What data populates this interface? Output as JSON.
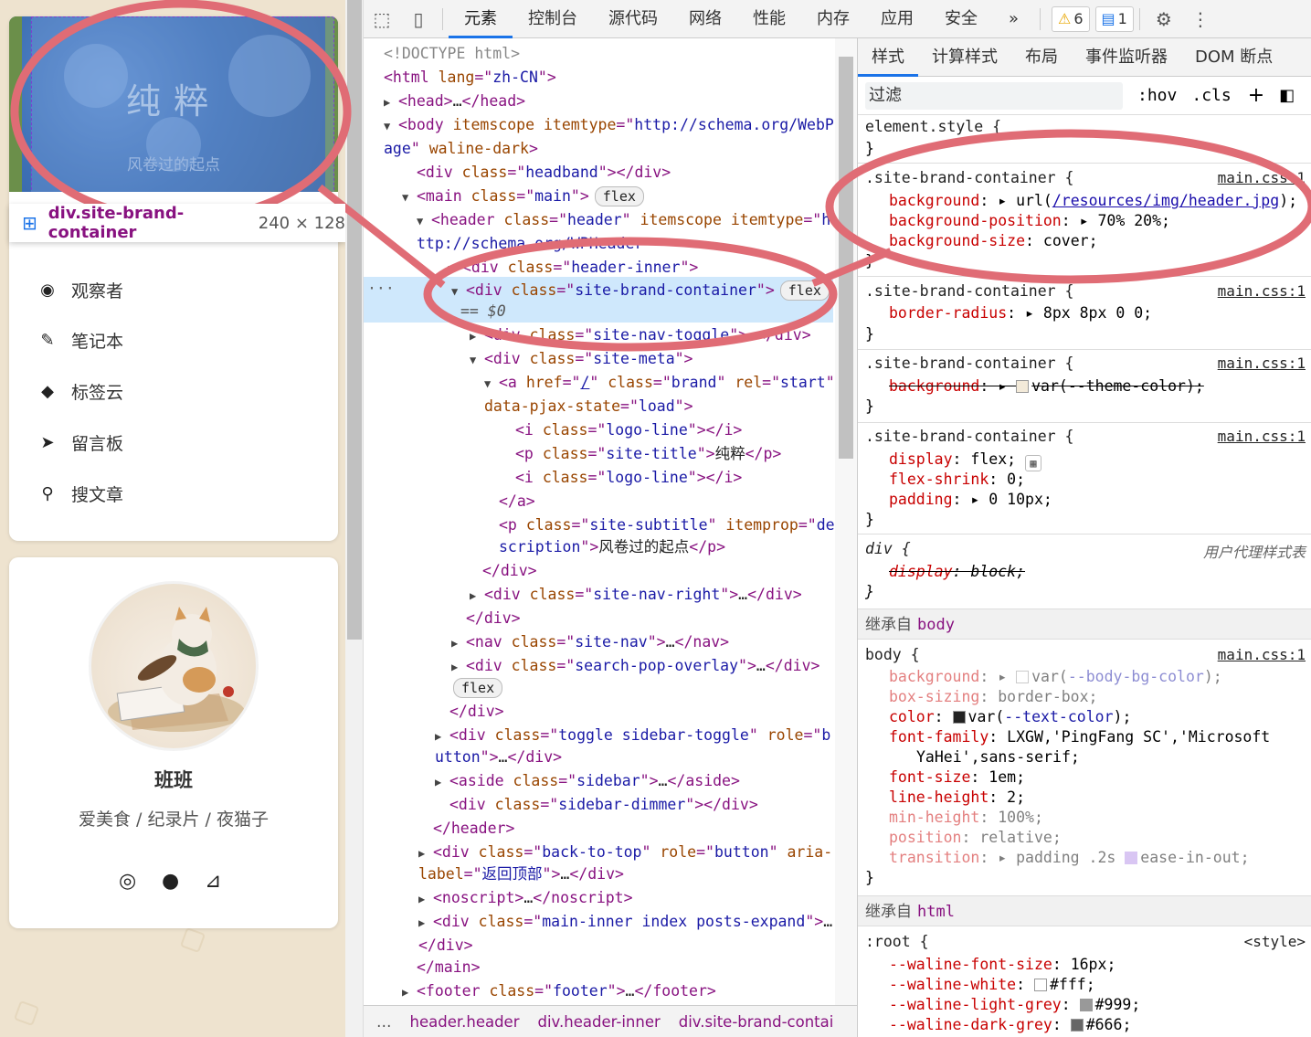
{
  "site": {
    "title": "纯粹",
    "subtitle": "风卷过的起点",
    "inspect_tooltip": {
      "selector": "div.site-brand-container",
      "size": "240 × 128"
    },
    "menu": [
      {
        "label": "观察者",
        "icon": "eye-icon"
      },
      {
        "label": "笔记本",
        "icon": "pencil-icon"
      },
      {
        "label": "标签云",
        "icon": "tags-icon"
      },
      {
        "label": "留言板",
        "icon": "send-icon"
      },
      {
        "label": "搜文章",
        "icon": "search-icon"
      }
    ],
    "profile": {
      "name": "班班",
      "description": "爱美食 / 纪录片 / 夜猫子",
      "social": [
        "weibo-icon",
        "github-icon",
        "rss-icon"
      ]
    }
  },
  "devtools": {
    "tabs": [
      "元素",
      "控制台",
      "源代码",
      "网络",
      "性能",
      "内存",
      "应用",
      "安全"
    ],
    "active_tab": "元素",
    "more": "»",
    "warnings": "6",
    "messages": "1",
    "elements": {
      "doctype": "<!DOCTYPE html>",
      "html_lang": "zh-CN",
      "body_itemtype_1": "http://schema.org/WebP",
      "body_itemtype_2": "age",
      "header_itemtype_1": "h",
      "header_itemtype_2": "ttp://schema.org/WPHeader",
      "site_title": "纯粹",
      "site_subtitle": "风卷过的起点",
      "selected_marker": "== $0",
      "back_to_top_label": "返回顶部",
      "breadcrumbs": [
        "header.header",
        "div.header-inner",
        "div.site-brand-contai"
      ]
    },
    "styles": {
      "tabs": [
        "样式",
        "计算样式",
        "布局",
        "事件监听器",
        "DOM 断点"
      ],
      "active_tab": "样式",
      "filter_placeholder": "过滤",
      "hov": ":hov",
      "cls": ".cls",
      "source": "main.css:1",
      "ua_source": "用户代理样式表",
      "style_source": "<style>",
      "header_img": "/resources/img/header.jpg",
      "bg_position": "70% 20%",
      "bg_size": "cover",
      "radius": "8px 8px 0 0",
      "theme_color": "var(--theme-color)",
      "inherited_body": "body",
      "inherited_html": "html",
      "inherited_label": "继承自",
      "body_font": "LXGW,'PingFang SC','Microsoft",
      "body_font_2": "YaHei',sans-serif;",
      "root_vars": [
        {
          "name": "--waline-font-size",
          "value": "16px"
        },
        {
          "name": "--waline-white",
          "value": "#fff"
        },
        {
          "name": "--waline-light-grey",
          "value": "#999"
        },
        {
          "name": "--waline-dark-grey",
          "value": "#666"
        }
      ]
    }
  },
  "colors": {
    "highlight": "#e06c75",
    "selected_row": "#cfe8fc",
    "accent": "#1a73e8"
  }
}
